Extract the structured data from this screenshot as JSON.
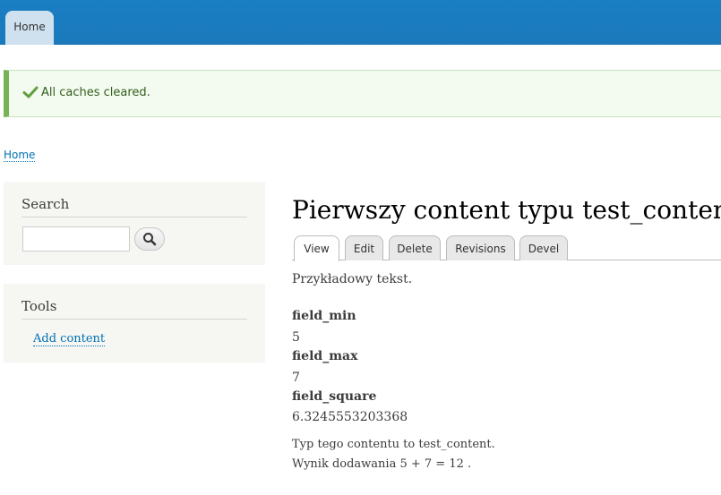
{
  "top_nav": {
    "home_tab": "Home"
  },
  "status": {
    "message": "All caches cleared."
  },
  "breadcrumb": {
    "home": "Home"
  },
  "sidebar": {
    "search": {
      "title": "Search",
      "input_value": "",
      "button_icon": "search-icon"
    },
    "tools": {
      "title": "Tools",
      "add_content": "Add content"
    }
  },
  "main": {
    "title": "Pierwszy content typu test_content",
    "tabs": [
      {
        "label": "View",
        "active": true
      },
      {
        "label": "Edit",
        "active": false
      },
      {
        "label": "Delete",
        "active": false
      },
      {
        "label": "Revisions",
        "active": false
      },
      {
        "label": "Devel",
        "active": false
      }
    ],
    "body": "Przykładowy tekst.",
    "fields": [
      {
        "label": "field_min",
        "value": "5"
      },
      {
        "label": "field_max",
        "value": "7"
      },
      {
        "label": "field_square",
        "value": "6.3245553203368"
      }
    ],
    "footer_lines": [
      "Typ tego contentu to test_content.",
      "Wynik dodawania 5 + 7 = 12 ."
    ]
  },
  "colors": {
    "toolbar_blue": "#1b7bc0",
    "link_blue": "#0071b3",
    "status_green": "#77b259",
    "status_bg": "#f3faef"
  }
}
